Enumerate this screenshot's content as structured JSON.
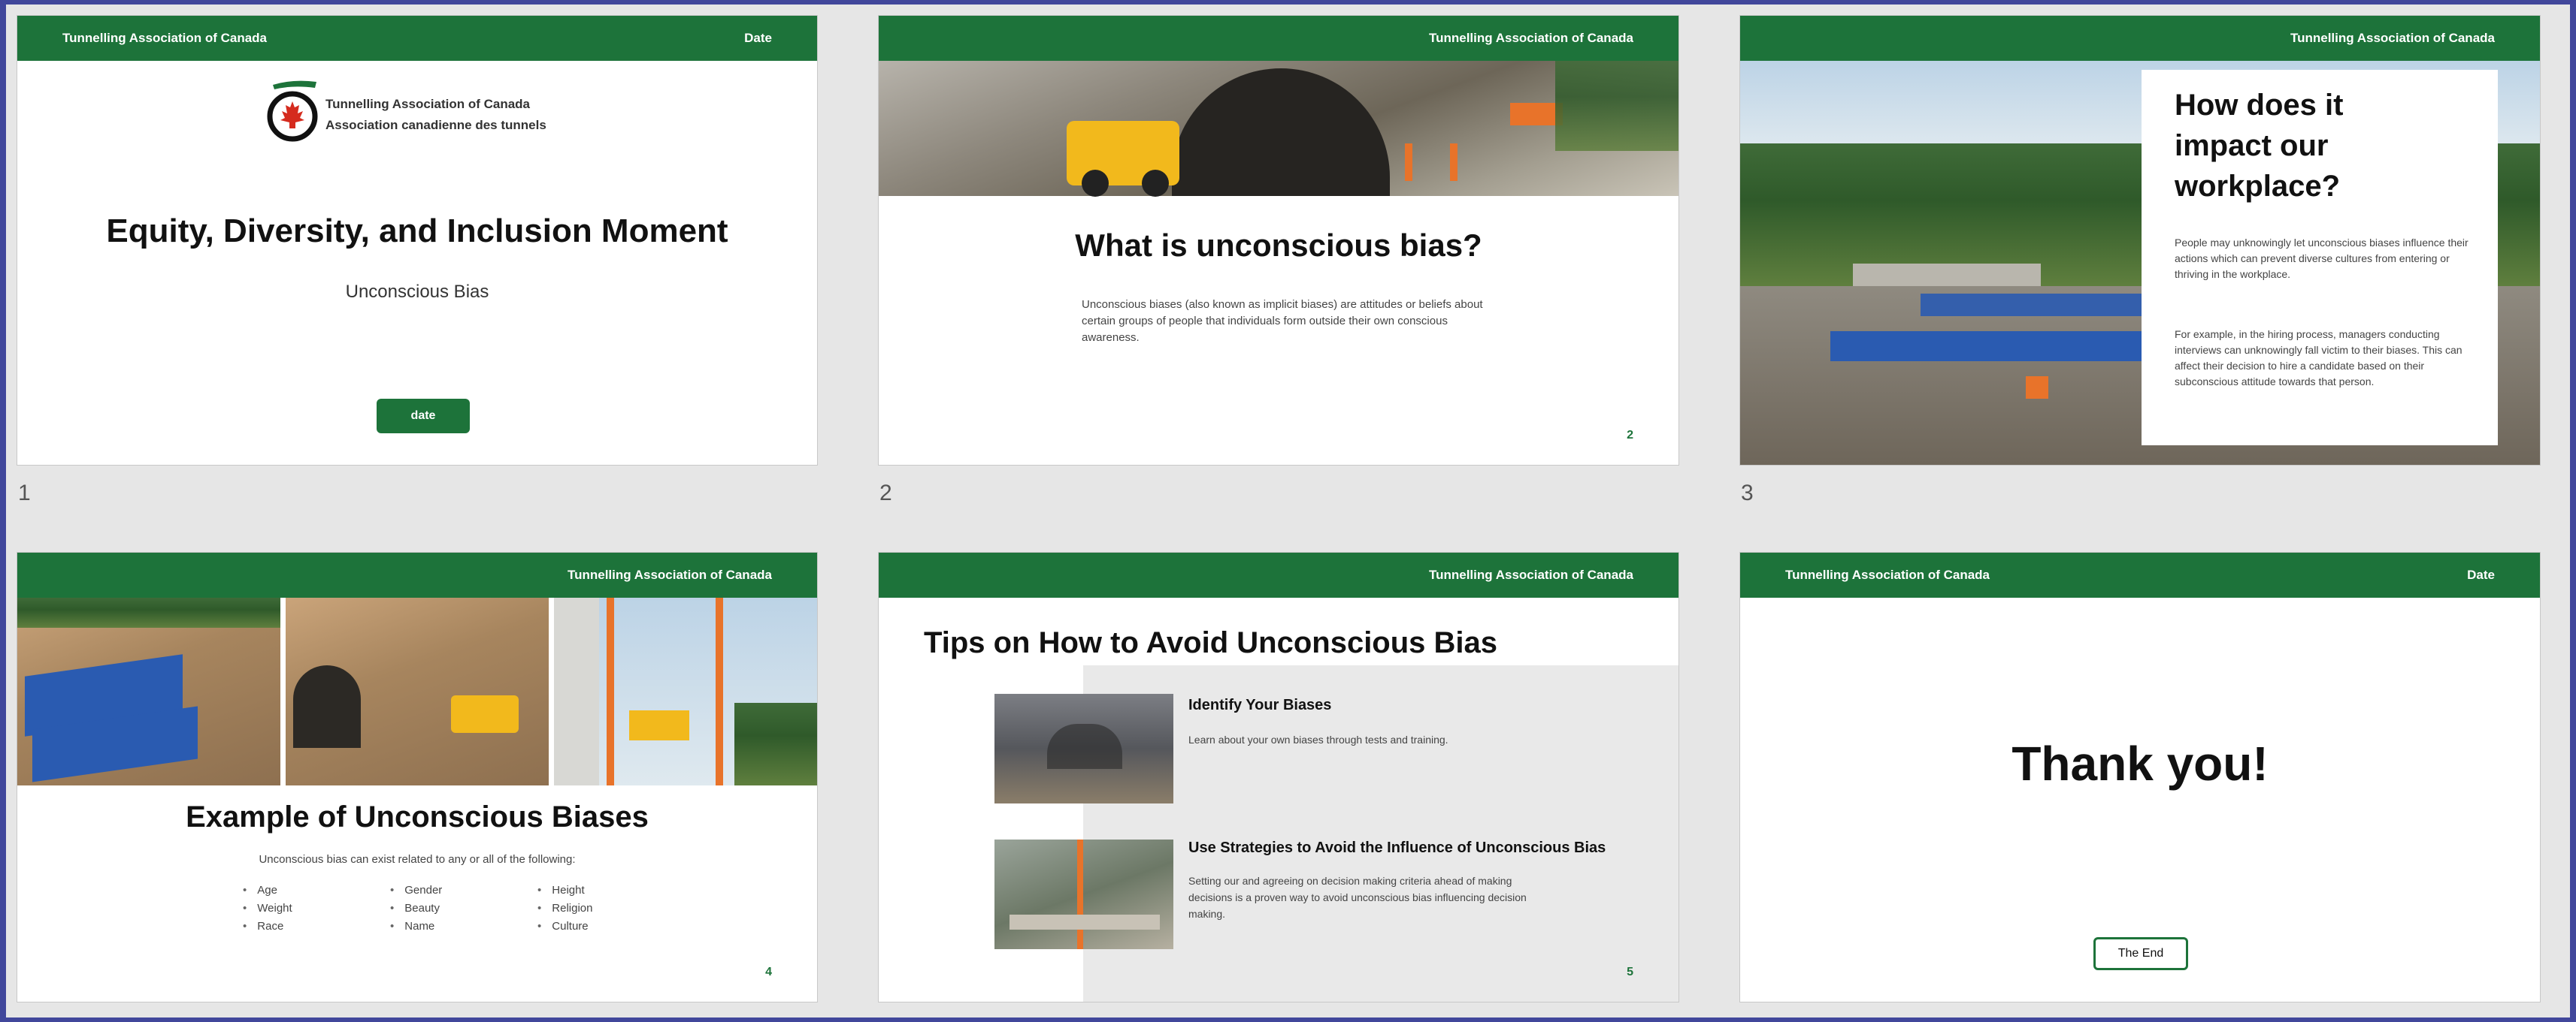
{
  "slides": [
    {
      "number": "1",
      "header_left": "Tunnelling Association of Canada",
      "header_right": "Date",
      "org_en": "Tunnelling Association of Canada",
      "org_fr": "Association canadienne des tunnels",
      "title": "Equity, Diversity, and Inclusion Moment",
      "subtitle": "Unconscious Bias",
      "button": "date"
    },
    {
      "number": "2",
      "header_right": "Tunnelling Association of Canada",
      "title": "What is unconscious bias?",
      "body": "Unconscious biases (also known as implicit biases) are attitudes or beliefs about certain groups of people that individuals form outside their own conscious awareness.",
      "page": "2"
    },
    {
      "number": "3",
      "header_right": "Tunnelling Association of Canada",
      "title": "How does it impact our workplace?",
      "p1": "People may unknowingly let unconscious biases influence their actions which can prevent diverse cultures from entering or thriving in the workplace.",
      "p2": "For example, in the hiring process, managers conducting interviews can unknowingly fall victim to their biases. This can affect their decision to hire a candidate based on their subconscious attitude towards that person."
    },
    {
      "header_right": "Tunnelling Association of Canada",
      "title": "Example of Unconscious Biases",
      "intro": "Unconscious bias can exist related to any or all of the following:",
      "col1": [
        "Age",
        "Weight",
        "Race"
      ],
      "col2": [
        "Gender",
        "Beauty",
        "Name"
      ],
      "col3": [
        "Height",
        "Religion",
        "Culture"
      ],
      "page": "4"
    },
    {
      "header_right": "Tunnelling Association of Canada",
      "title": "Tips on How to Avoid Unconscious Bias",
      "tip1_title": "Identify Your Biases",
      "tip1_body": "Learn about your own biases through tests and training.",
      "tip2_title": "Use Strategies to Avoid the Influence of Unconscious Bias",
      "tip2_body": "Setting our and agreeing on decision making criteria ahead of making decisions is a proven way to avoid unconscious bias influencing decision making.",
      "page": "5"
    },
    {
      "header_left": "Tunnelling Association of Canada",
      "header_right": "Date",
      "title": "Thank you!",
      "button": "The End"
    }
  ],
  "colors": {
    "brand_green": "#1d733a",
    "frame": "#41479b",
    "canvas": "#e6e6e6"
  }
}
